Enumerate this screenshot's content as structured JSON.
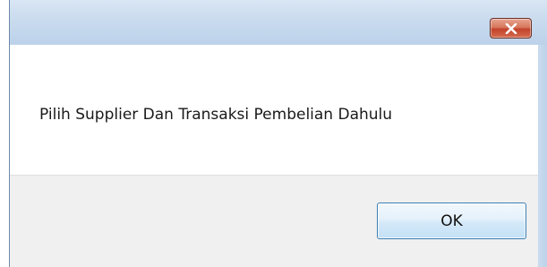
{
  "dialog": {
    "title": "",
    "message": "Pilih Supplier Dan Transaksi Pembelian Dahulu",
    "ok_label": "OK",
    "close_icon": "close-icon"
  },
  "colors": {
    "titlebar": "#c9dbee",
    "close_button": "#c2432a",
    "button_area": "#f0f0f0",
    "ok_border": "#3c7fb1"
  }
}
